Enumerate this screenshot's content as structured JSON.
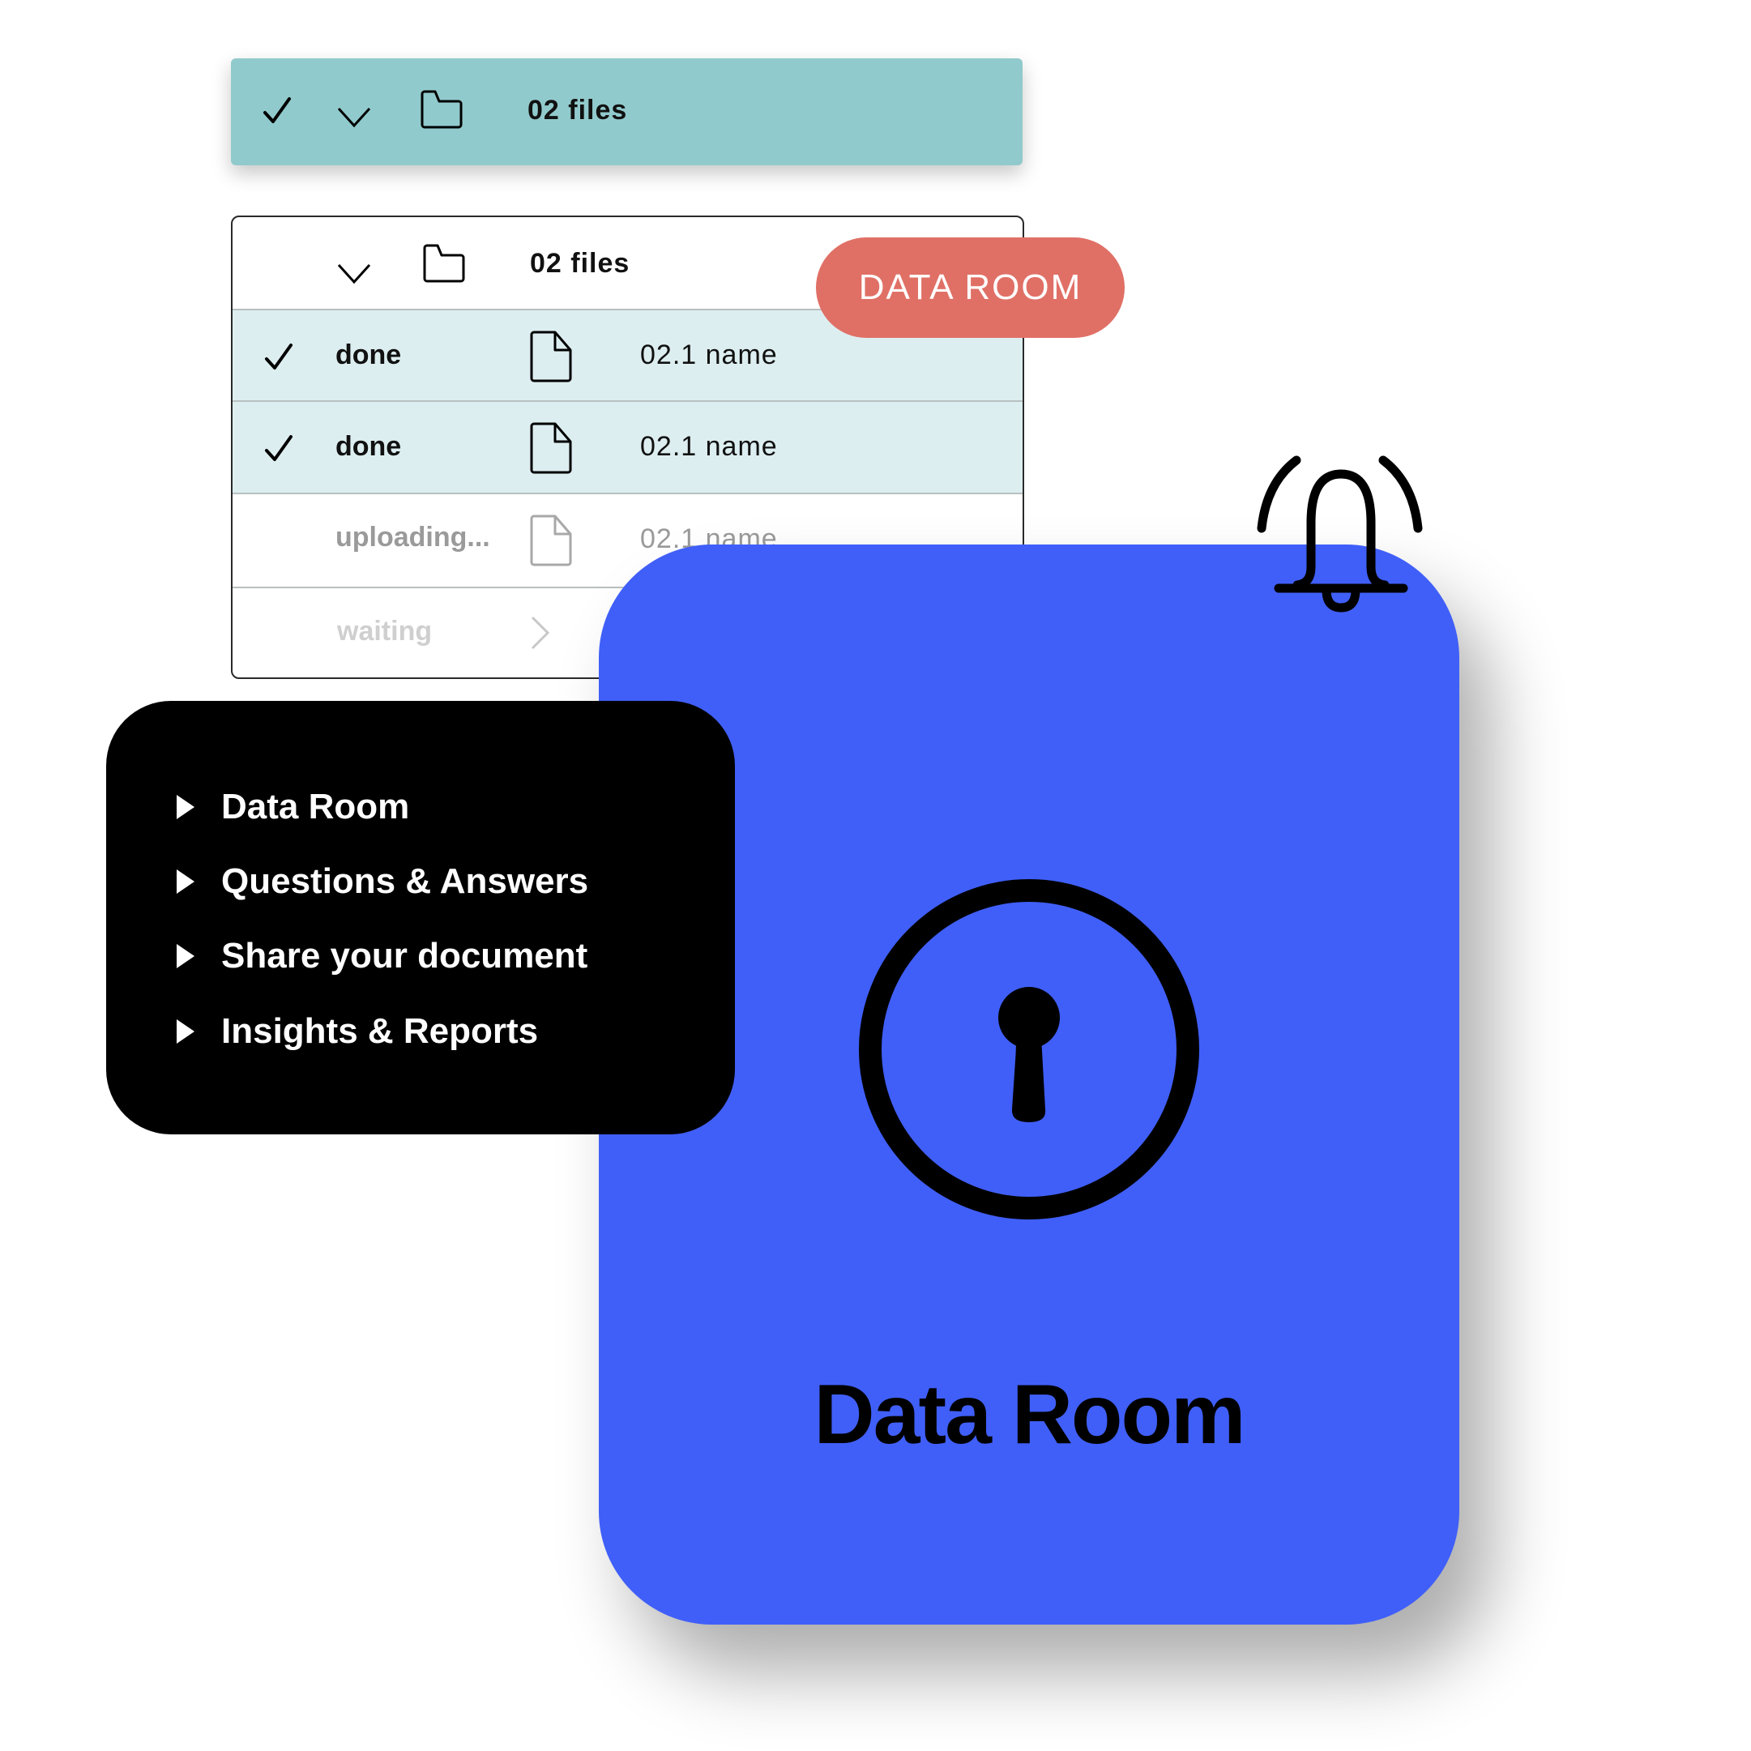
{
  "top_bar": {
    "label": "02 files",
    "icons": [
      "check-icon",
      "chevron-down-icon",
      "folder-icon"
    ],
    "background": "#91CACC"
  },
  "file_table": {
    "header": {
      "label": "02 files",
      "icons": [
        "chevron-down-icon",
        "folder-icon"
      ]
    },
    "rows": [
      {
        "status": "done",
        "name": "02.1 name",
        "state": "done",
        "checked": true
      },
      {
        "status": "done",
        "name": "02.1 name",
        "state": "done",
        "checked": true
      },
      {
        "status": "uploading...",
        "name": "02.1 name",
        "state": "uploading",
        "checked": false
      },
      {
        "status": "waiting",
        "name": "",
        "state": "waiting",
        "checked": false
      }
    ],
    "selected_row_color": "#DDEEF0"
  },
  "badge": {
    "label": "DATA ROOM",
    "color": "#E07066"
  },
  "menu": {
    "items": [
      {
        "label": "Data Room"
      },
      {
        "label": "Questions & Answers"
      },
      {
        "label": "Share your document"
      },
      {
        "label": "Insights & Reports"
      }
    ]
  },
  "card": {
    "title": "Data Room",
    "icon": "keyhole-lock-icon",
    "background": "#405FF8"
  },
  "notification": {
    "icon": "bell-ringing-icon"
  }
}
